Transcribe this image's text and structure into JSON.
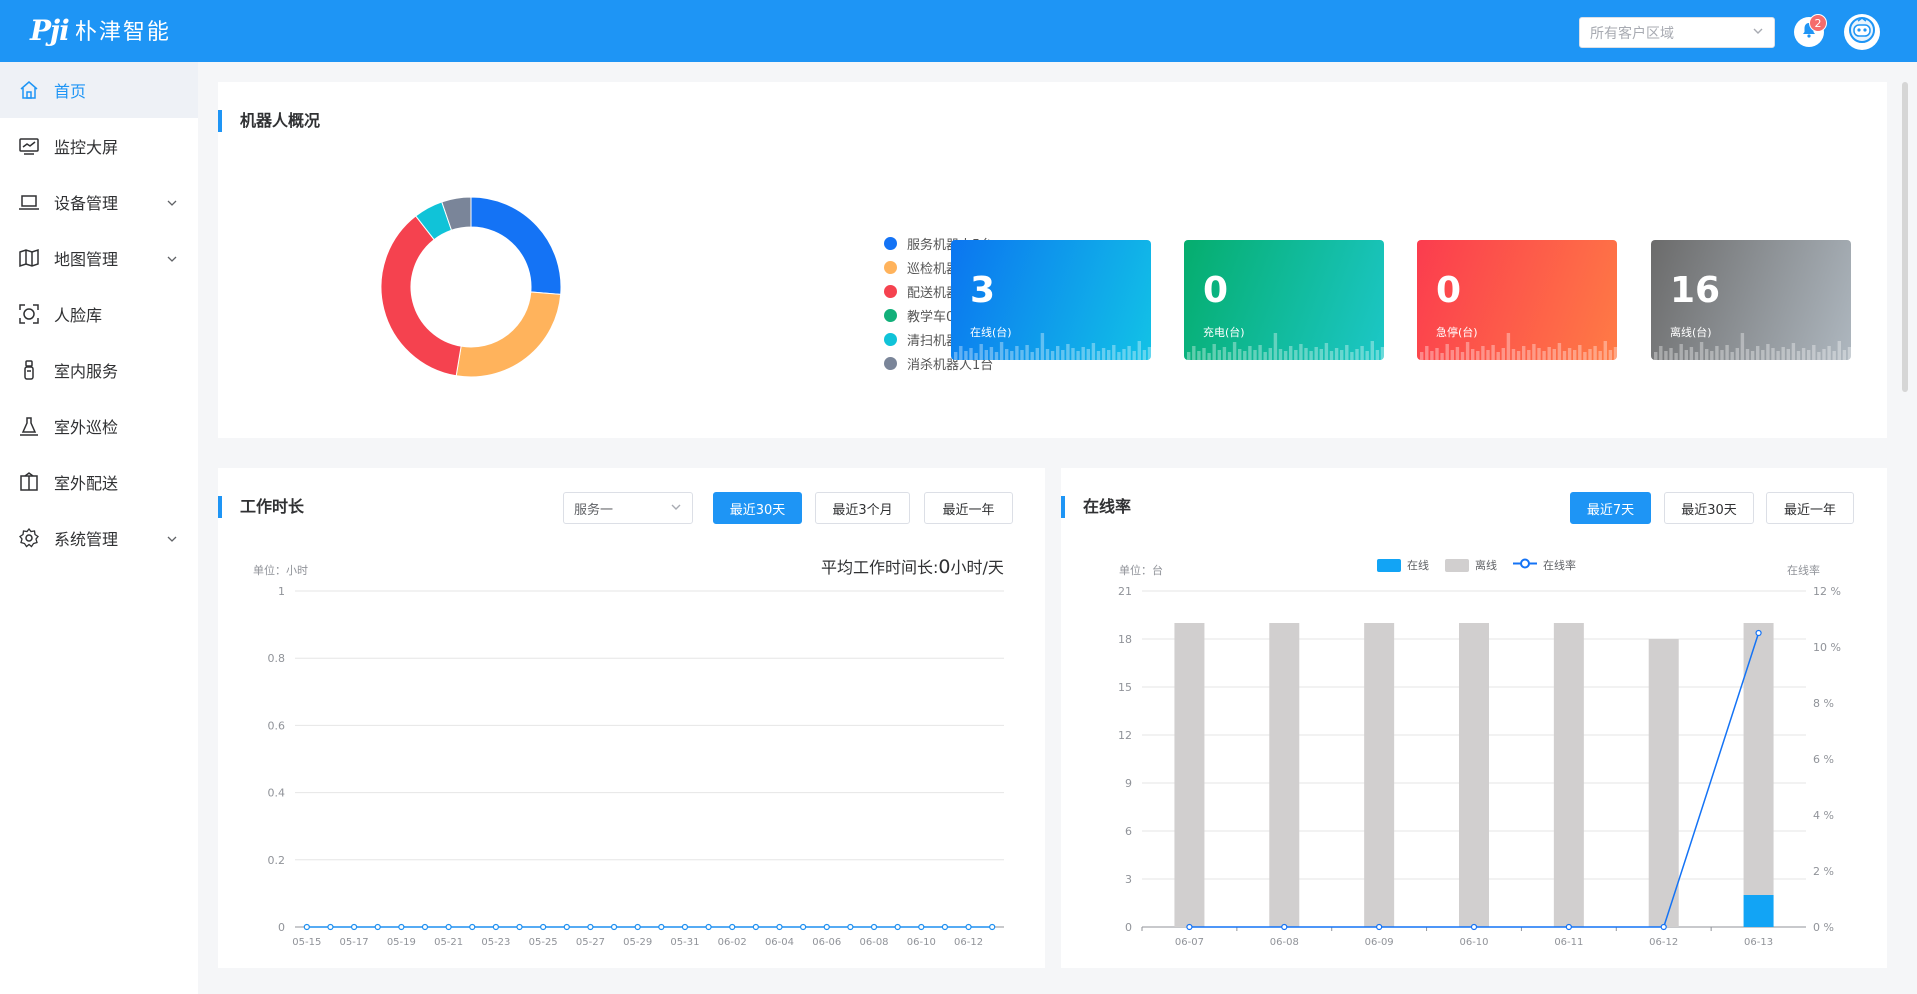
{
  "header": {
    "logo_mark": "Pji",
    "logo_text": "朴津智能",
    "region_placeholder": "所有客户区域",
    "notification_count": "2"
  },
  "sidebar": {
    "items": [
      {
        "label": "首页",
        "icon": "home-icon",
        "active": true
      },
      {
        "label": "监控大屏",
        "icon": "monitor-chart-icon"
      },
      {
        "label": "设备管理",
        "icon": "laptop-icon",
        "expandable": true
      },
      {
        "label": "地图管理",
        "icon": "map-icon",
        "expandable": true
      },
      {
        "label": "人脸库",
        "icon": "face-scan-icon"
      },
      {
        "label": "室内服务",
        "icon": "robot-icon"
      },
      {
        "label": "室外巡检",
        "icon": "patrol-icon"
      },
      {
        "label": "室外配送",
        "icon": "delivery-box-icon"
      },
      {
        "label": "系统管理",
        "icon": "gear-icon",
        "expandable": true
      }
    ]
  },
  "overview": {
    "title": "机器人概况",
    "legend": [
      {
        "label": "服务机器人5台",
        "color": "#1473f5"
      },
      {
        "label": "巡检机器人5台",
        "color": "#ffb35c"
      },
      {
        "label": "配送机器人7台",
        "color": "#f5424f"
      },
      {
        "label": "教学车0台",
        "color": "#12b07a"
      },
      {
        "label": "清扫机器人1台",
        "color": "#10c3d8"
      },
      {
        "label": "消杀机器人1台",
        "color": "#7a8599"
      }
    ],
    "stats": [
      {
        "value": "3",
        "label": "在线(台)",
        "from": "#0b75f0",
        "to": "#12c2e6"
      },
      {
        "value": "0",
        "label": "充电(台)",
        "from": "#05ad6d",
        "to": "#1cc7c7"
      },
      {
        "value": "0",
        "label": "急停(台)",
        "from": "#fb3c4e",
        "to": "#ff7b45"
      },
      {
        "value": "16",
        "label": "离线(台)",
        "from": "#6b6b6b",
        "to": "#aeb7bf"
      }
    ]
  },
  "worktime": {
    "title": "工作时长",
    "select_value": "服务一",
    "buttons": [
      "最近30天",
      "最近3个月",
      "最近一年"
    ],
    "active_button": 0,
    "unit_label": "单位：小时",
    "avg_prefix": "平均工作时间长:",
    "avg_value": "0",
    "avg_suffix": "小时/天"
  },
  "online": {
    "title": "在线率",
    "buttons": [
      "最近7天",
      "最近30天",
      "最近一年"
    ],
    "active_button": 0,
    "unit_label": "单位：台",
    "right_axis_label": "在线率",
    "legend": {
      "online": "在线",
      "offline": "离线",
      "rate": "在线率"
    }
  },
  "chart_data": [
    {
      "type": "pie",
      "title": "",
      "categories": [
        "服务机器人",
        "巡检机器人",
        "配送机器人",
        "教学车",
        "清扫机器人",
        "消杀机器人"
      ],
      "values": [
        5,
        5,
        7,
        0,
        1,
        1
      ],
      "colors": [
        "#1473f5",
        "#ffb35c",
        "#f5424f",
        "#12b07a",
        "#10c3d8",
        "#7a8599"
      ]
    },
    {
      "type": "line",
      "title": "",
      "x": [
        "05-15",
        "05-16",
        "05-17",
        "05-18",
        "05-19",
        "05-20",
        "05-21",
        "05-22",
        "05-23",
        "05-24",
        "05-25",
        "05-26",
        "05-27",
        "05-28",
        "05-29",
        "05-30",
        "05-31",
        "06-01",
        "06-02",
        "06-03",
        "06-04",
        "06-05",
        "06-06",
        "06-07",
        "06-08",
        "06-09",
        "06-10",
        "06-11",
        "06-12",
        "06-13"
      ],
      "xticks": [
        "05-15",
        "05-17",
        "05-19",
        "05-21",
        "05-23",
        "05-25",
        "05-27",
        "05-29",
        "05-31",
        "06-02",
        "06-04",
        "06-06",
        "06-08",
        "06-10",
        "06-12"
      ],
      "values": [
        0,
        0,
        0,
        0,
        0,
        0,
        0,
        0,
        0,
        0,
        0,
        0,
        0,
        0,
        0,
        0,
        0,
        0,
        0,
        0,
        0,
        0,
        0,
        0,
        0,
        0,
        0,
        0,
        0,
        0
      ],
      "ylim": [
        0,
        1
      ],
      "yticks": [
        0,
        0.2,
        0.4,
        0.6,
        0.8,
        1
      ],
      "ylabel": "单位：小时",
      "color": "#1e8ff0"
    },
    {
      "type": "bar",
      "title": "",
      "categories": [
        "06-07",
        "06-08",
        "06-09",
        "06-10",
        "06-11",
        "06-12",
        "06-13"
      ],
      "series": [
        {
          "name": "在线",
          "values": [
            0,
            0,
            0,
            0,
            0,
            0,
            2
          ],
          "color": "#12a4f5"
        },
        {
          "name": "离线",
          "values": [
            19,
            19,
            19,
            19,
            19,
            18,
            17
          ],
          "color": "#d1cfcf"
        },
        {
          "name": "在线率",
          "values": [
            0,
            0,
            0,
            0,
            0,
            0,
            10.5
          ],
          "axis": "right",
          "color": "#1473f5",
          "kind": "line"
        }
      ],
      "ylim": [
        0,
        21
      ],
      "yticks": [
        0,
        3,
        6,
        9,
        12,
        15,
        18,
        21
      ],
      "y2lim": [
        0,
        12
      ],
      "y2ticks": [
        "0 %",
        "2 %",
        "4 %",
        "6 %",
        "8 %",
        "10 %",
        "12 %"
      ],
      "ylabel": "单位：台",
      "y2label": "在线率",
      "stacked": true
    }
  ]
}
